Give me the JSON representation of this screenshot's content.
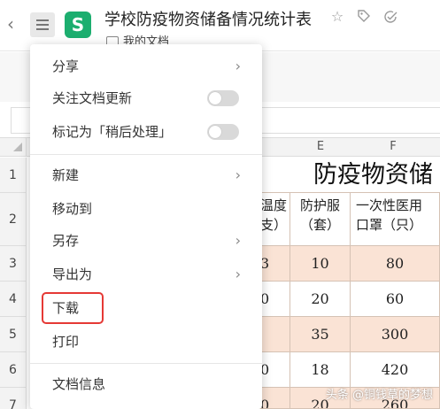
{
  "header": {
    "title": "学校防疫物资储备情况统计表",
    "folder": "我的文档",
    "logo_letter": "S",
    "logo_color": "#1cae6f",
    "icons": [
      "back-chevron-icon",
      "hamburger-menu-icon",
      "star-icon",
      "tag-icon",
      "check-circle-icon"
    ]
  },
  "menu": {
    "items": [
      {
        "label": "分享",
        "chevron": true
      },
      {
        "label": "关注文档更新",
        "toggle": false
      },
      {
        "label": "标记为「稍后处理」",
        "toggle": false
      },
      {
        "label": "新建",
        "chevron": true
      },
      {
        "label": "移动到"
      },
      {
        "label": "另存",
        "chevron": true
      },
      {
        "label": "导出为",
        "chevron": true
      },
      {
        "label": "下载",
        "highlighted": true
      },
      {
        "label": "打印"
      },
      {
        "label": "文档信息"
      }
    ],
    "highlight_color": "#e53935"
  },
  "sheet": {
    "row_numbers": [
      "1",
      "2",
      "3",
      "4",
      "5",
      "6",
      "7"
    ],
    "col_letters": [
      "E",
      "F"
    ],
    "title_partial": "防疫物资储",
    "headers": {
      "d_partial": "温度\n支）",
      "e": "防护服\n（套）",
      "f": "一次性医用\n口罩（只）"
    },
    "rows": [
      {
        "d": "3",
        "e": "10",
        "f": "80"
      },
      {
        "d": "0",
        "e": "20",
        "f": "60"
      },
      {
        "d": "",
        "e": "35",
        "f": "300"
      },
      {
        "d": "0",
        "e": "18",
        "f": "420"
      },
      {
        "d": "0",
        "e": "20",
        "f": "260"
      }
    ],
    "peach_color": "#fae3d5"
  },
  "watermark": "头条 @铜钱草的梦想"
}
